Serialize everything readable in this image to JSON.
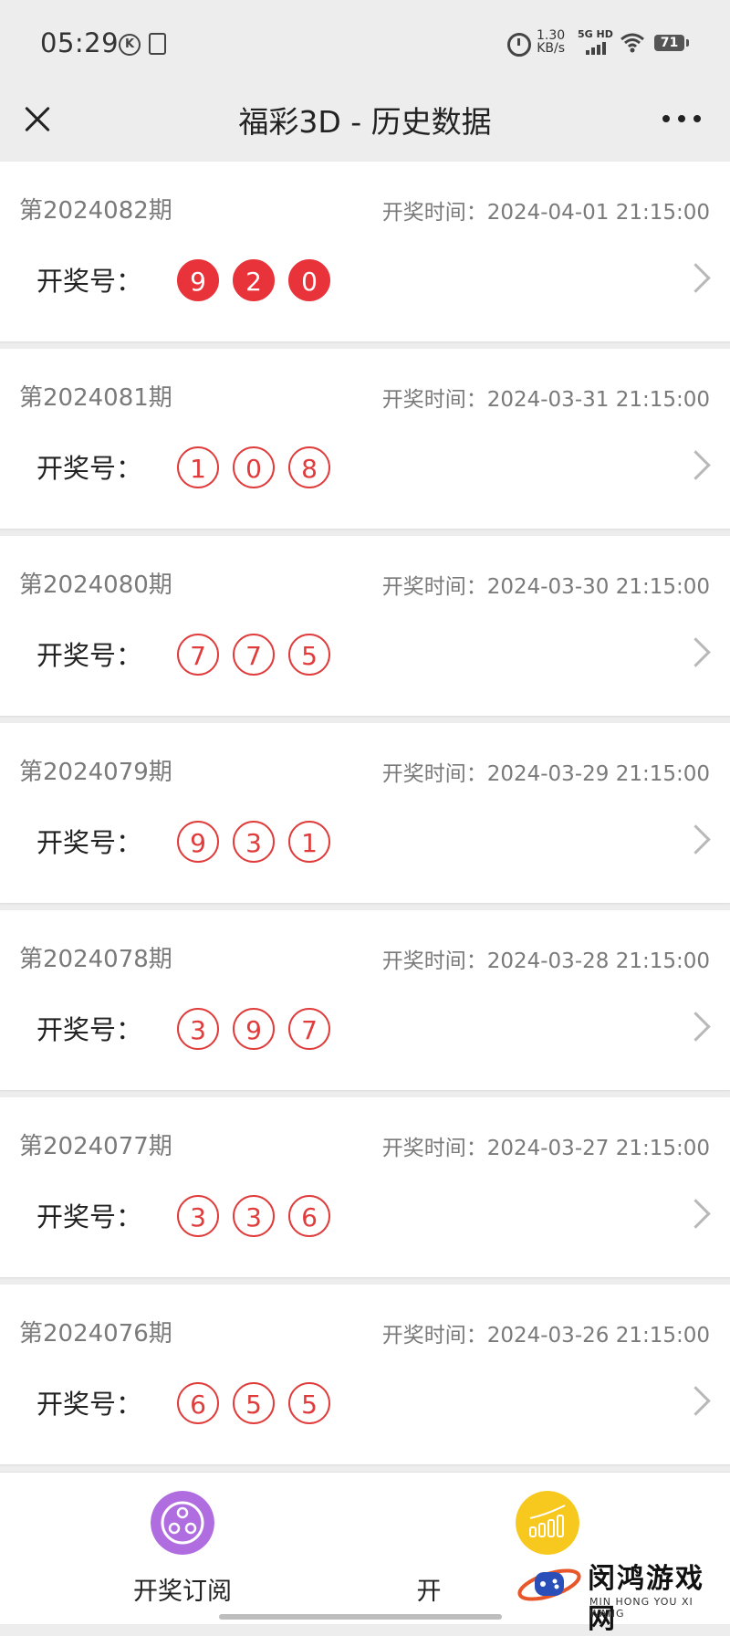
{
  "status_bar": {
    "time": "05:29",
    "speed_value": "1.30",
    "speed_unit": "KB/s",
    "network": "5G HD",
    "battery": "71"
  },
  "header": {
    "title": "福彩3D - 历史数据"
  },
  "records": [
    {
      "issue": "第2024082期",
      "draw_time": "开奖时间：2024-04-01 21:15:00",
      "label": "开奖号：",
      "numbers": [
        "9",
        "2",
        "0"
      ],
      "style": "filled"
    },
    {
      "issue": "第2024081期",
      "draw_time": "开奖时间：2024-03-31 21:15:00",
      "label": "开奖号：",
      "numbers": [
        "1",
        "0",
        "8"
      ],
      "style": "outline"
    },
    {
      "issue": "第2024080期",
      "draw_time": "开奖时间：2024-03-30 21:15:00",
      "label": "开奖号：",
      "numbers": [
        "7",
        "7",
        "5"
      ],
      "style": "outline"
    },
    {
      "issue": "第2024079期",
      "draw_time": "开奖时间：2024-03-29 21:15:00",
      "label": "开奖号：",
      "numbers": [
        "9",
        "3",
        "1"
      ],
      "style": "outline"
    },
    {
      "issue": "第2024078期",
      "draw_time": "开奖时间：2024-03-28 21:15:00",
      "label": "开奖号：",
      "numbers": [
        "3",
        "9",
        "7"
      ],
      "style": "outline"
    },
    {
      "issue": "第2024077期",
      "draw_time": "开奖时间：2024-03-27 21:15:00",
      "label": "开奖号：",
      "numbers": [
        "3",
        "3",
        "6"
      ],
      "style": "outline"
    },
    {
      "issue": "第2024076期",
      "draw_time": "开奖时间：2024-03-26 21:15:00",
      "label": "开奖号：",
      "numbers": [
        "6",
        "5",
        "5"
      ],
      "style": "outline"
    }
  ],
  "bottom_nav": {
    "items": [
      {
        "label": "开奖订阅",
        "icon": "subscribe-icon",
        "color": "#b06de0"
      },
      {
        "label": "开",
        "icon": "trend-chart-icon",
        "color": "#f7c81e"
      }
    ]
  },
  "watermark": {
    "text": "闵鸿游戏网",
    "sub": "MIN HONG YOU XI WANG"
  },
  "colors": {
    "ball_red": "#e8333a",
    "background": "#ededed"
  }
}
